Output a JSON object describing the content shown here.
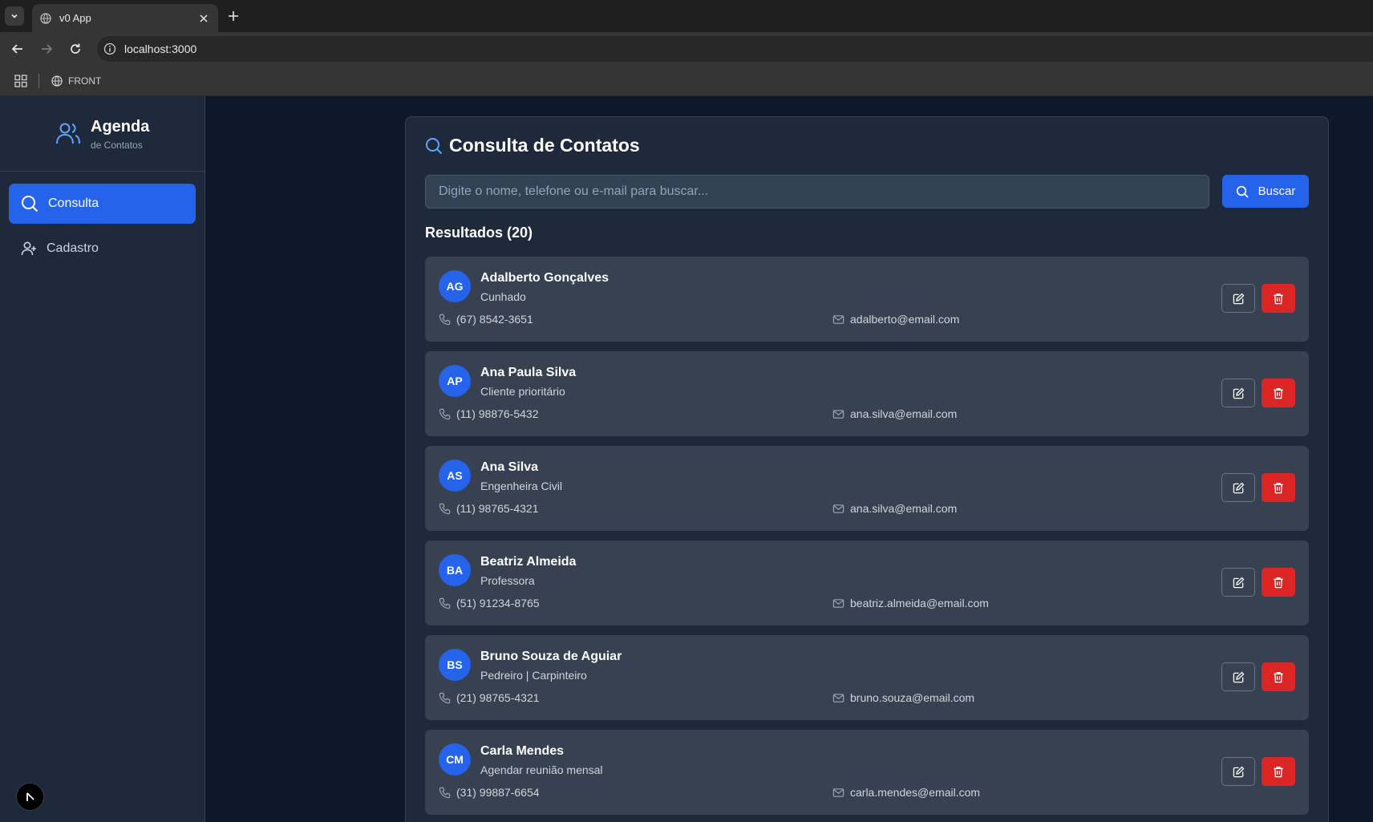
{
  "browser": {
    "tab_title": "v0 App",
    "url": "localhost:3000",
    "bookmark_label": "FRONT"
  },
  "sidebar": {
    "brand_title": "Agenda",
    "brand_subtitle": "de Contatos",
    "items": [
      {
        "label": "Consulta",
        "icon": "search-icon",
        "active": true
      },
      {
        "label": "Cadastro",
        "icon": "user-plus-icon",
        "active": false
      }
    ]
  },
  "main": {
    "title": "Consulta de Contatos",
    "search": {
      "placeholder": "Digite o nome, telefone ou e-mail para buscar...",
      "value": "",
      "button_label": "Buscar"
    },
    "results_label": "Resultados (20)",
    "contacts": [
      {
        "initials": "AG",
        "name": "Adalberto Gonçalves",
        "note": "Cunhado",
        "phone": "(67) 8542-3651",
        "email": "adalberto@email.com"
      },
      {
        "initials": "AP",
        "name": "Ana Paula Silva",
        "note": "Cliente prioritário",
        "phone": "(11) 98876-5432",
        "email": "ana.silva@email.com"
      },
      {
        "initials": "AS",
        "name": "Ana Silva",
        "note": "Engenheira Civil",
        "phone": "(11) 98765-4321",
        "email": "ana.silva@email.com"
      },
      {
        "initials": "BA",
        "name": "Beatriz Almeida",
        "note": "Professora",
        "phone": "(51) 91234-8765",
        "email": "beatriz.almeida@email.com"
      },
      {
        "initials": "BS",
        "name": "Bruno Souza de Aguiar",
        "note": "Pedreiro | Carpinteiro",
        "phone": "(21) 98765-4321",
        "email": "bruno.souza@email.com"
      },
      {
        "initials": "CM",
        "name": "Carla Mendes",
        "note": "Agendar reunião mensal",
        "phone": "(31) 99887-6654",
        "email": "carla.mendes@email.com"
      }
    ]
  },
  "colors": {
    "accent": "#2563eb",
    "danger": "#dc2626",
    "background": "#0f172a",
    "sidebar": "#1e293b",
    "card": "#374151"
  }
}
